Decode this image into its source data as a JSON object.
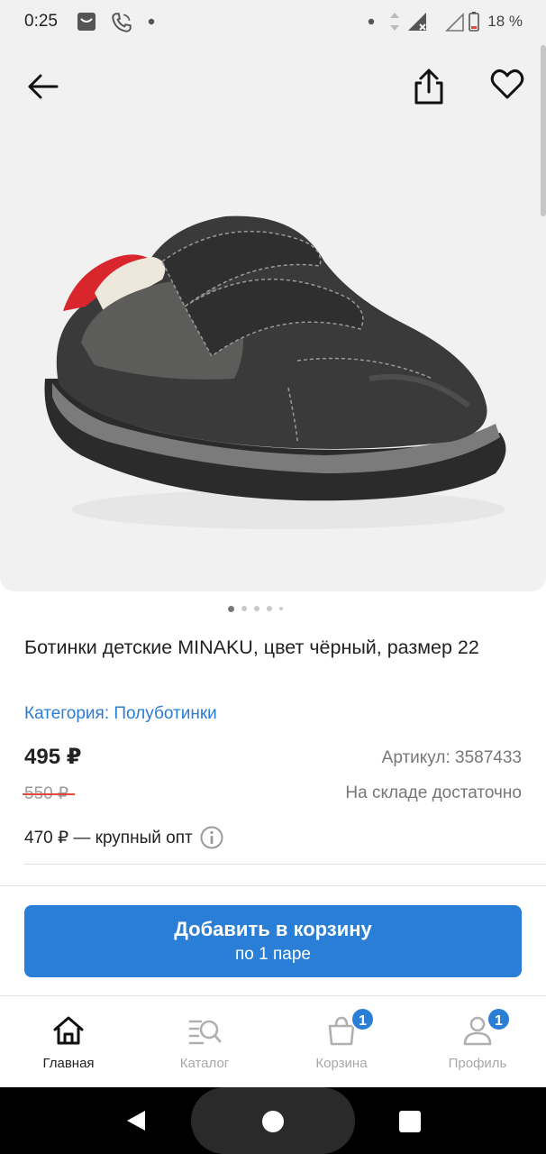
{
  "status_bar": {
    "time": "0:25",
    "battery_percent": "18 %"
  },
  "product": {
    "title": "Ботинки детские MINAKU, цвет чёрный, размер 22",
    "category": "Категория: Полуботинки",
    "price": "495 ₽",
    "sku": "Артикул: 3587433",
    "old_price": "550 ₽",
    "stock": "На складе достаточно",
    "wholesale": "470 ₽ — крупный опт",
    "image_count": 5,
    "active_image_index": 0
  },
  "cart_button": {
    "label": "Добавить в корзину",
    "sublabel": "по 1 паре"
  },
  "bottom_nav": {
    "items": [
      {
        "label": "Главная",
        "icon": "home-icon",
        "active": true
      },
      {
        "label": "Каталог",
        "icon": "catalog-search-icon",
        "active": false
      },
      {
        "label": "Корзина",
        "icon": "cart-bag-icon",
        "active": false,
        "badge": "1"
      },
      {
        "label": "Профиль",
        "icon": "profile-icon",
        "active": false,
        "badge": "1"
      }
    ]
  },
  "colors": {
    "accent": "#2b7ed6",
    "strike": "#e24a3b",
    "image_bg": "#f1f1f1"
  }
}
